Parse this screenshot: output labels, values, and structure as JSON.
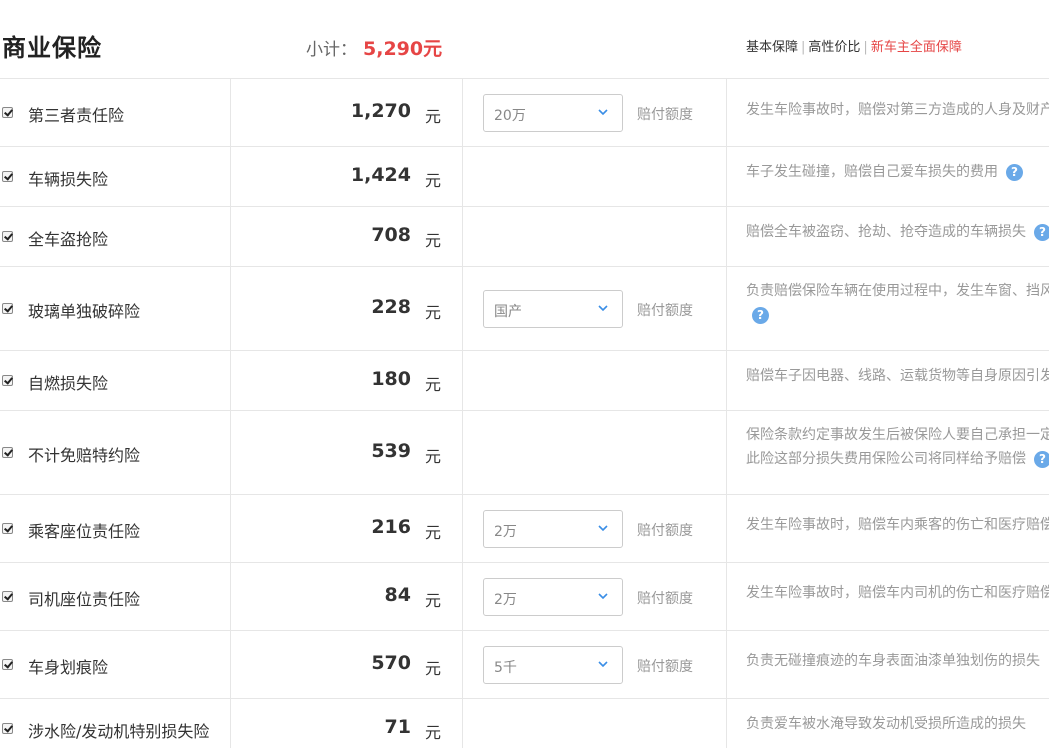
{
  "header": {
    "title": "商业保险",
    "subtotal_label": "小计：",
    "subtotal_value": "5,290元",
    "plans": [
      "基本保障",
      "高性价比",
      "新车主全面保障"
    ]
  },
  "unit": "元",
  "limit_label": "赔付额度",
  "rows": [
    {
      "name": "第三者责任险",
      "price": "1,270",
      "select": "20万",
      "desc": [
        "发生车险事故时，赔偿对第三方造成的人身及财产"
      ]
    },
    {
      "name": "车辆损失险",
      "price": "1,424",
      "select": null,
      "desc": [
        "车子发生碰撞，赔偿自己爱车损失的费用"
      ]
    },
    {
      "name": "全车盗抢险",
      "price": "708",
      "select": null,
      "desc": [
        "赔偿全车被盗窃、抢劫、抢夺造成的车辆损失"
      ]
    },
    {
      "name": "玻璃单独破碎险",
      "price": "228",
      "select": "国产",
      "desc": [
        "负责赔偿保险车辆在使用过程中，发生车窗、挡风"
      ]
    },
    {
      "name": "自燃损失险",
      "price": "180",
      "select": null,
      "desc": [
        "赔偿车子因电器、线路、运载货物等自身原因引发"
      ]
    },
    {
      "name": "不计免赔特约险",
      "price": "539",
      "select": null,
      "desc": [
        "保险条款约定事故发生后被保险人要自己承担一定",
        "此险这部分损失费用保险公司将同样给予赔偿"
      ]
    },
    {
      "name": "乘客座位责任险",
      "price": "216",
      "select": "2万",
      "desc": [
        "发生车险事故时，赔偿车内乘客的伤亡和医疗赔偿"
      ]
    },
    {
      "name": "司机座位责任险",
      "price": "84",
      "select": "2万",
      "desc": [
        "发生车险事故时，赔偿车内司机的伤亡和医疗赔偿"
      ]
    },
    {
      "name": "车身划痕险",
      "price": "570",
      "select": "5千",
      "desc": [
        "负责无碰撞痕迹的车身表面油漆单独划伤的损失"
      ]
    },
    {
      "name": "涉水险/发动机特别损失险",
      "price": "71",
      "select": null,
      "desc": [
        "负责爱车被水淹导致发动机受损所造成的损失"
      ]
    }
  ],
  "colors": {
    "accent": "#e64545",
    "help": "#6aa9e8",
    "border": "#e6e6e6"
  }
}
